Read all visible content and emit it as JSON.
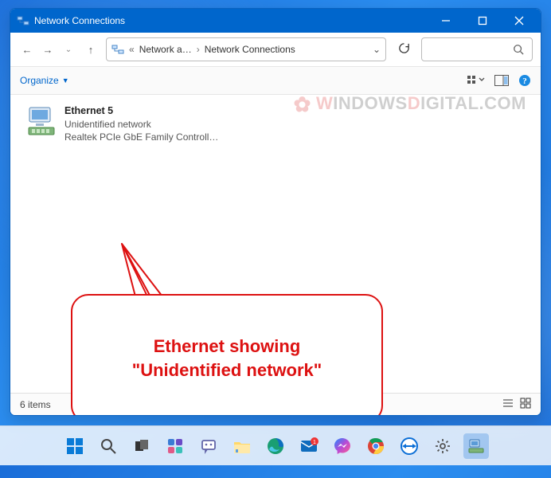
{
  "titlebar": {
    "title": "Network Connections"
  },
  "addressbar": {
    "crumb1": "Network a…",
    "crumb2": "Network Connections"
  },
  "commandbar": {
    "organize": "Organize"
  },
  "item": {
    "name": "Ethernet 5",
    "status": "Unidentified network",
    "adapter": "Realtek PCIe GbE Family Controll…"
  },
  "callout": {
    "line1": "Ethernet showing",
    "line2": "\"Unidentified network\""
  },
  "watermark": {
    "red": "W",
    "rest": "INDOWS",
    "red2": "D",
    "rest2": "IGITAL.COM"
  },
  "statusbar": {
    "count": "6 items"
  }
}
